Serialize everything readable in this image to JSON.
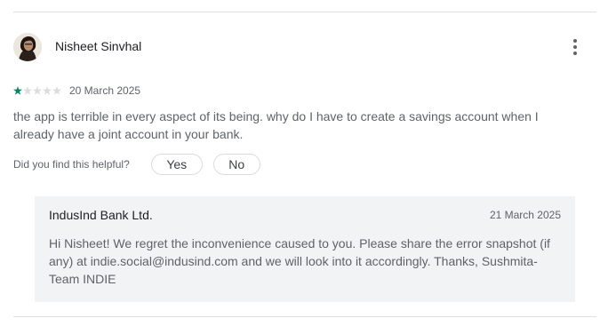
{
  "review": {
    "author": "Nisheet Sinvhal",
    "avatar_icon": "user-avatar-photo",
    "menu_icon": "more-vert-icon",
    "rating": 1,
    "rating_max": 5,
    "star_colors": {
      "filled": "#01875f",
      "empty": "#dadce0"
    },
    "date": "20 March 2025",
    "text": "the app is terrible in every aspect of its being. why do I have to create a savings account when I already have a joint account in your bank.",
    "helpful_question": "Did you find this helpful?",
    "yes_label": "Yes",
    "no_label": "No"
  },
  "reply": {
    "developer": "IndusInd Bank Ltd.",
    "date": "21 March 2025",
    "text": "Hi Nisheet! We regret the inconvenience caused to you. Please share the error snapshot (if any) at indie.social@indusind.com and we will look into it accordingly. Thanks, Sushmita- Team INDIE",
    "background": "#f1f3f4"
  }
}
